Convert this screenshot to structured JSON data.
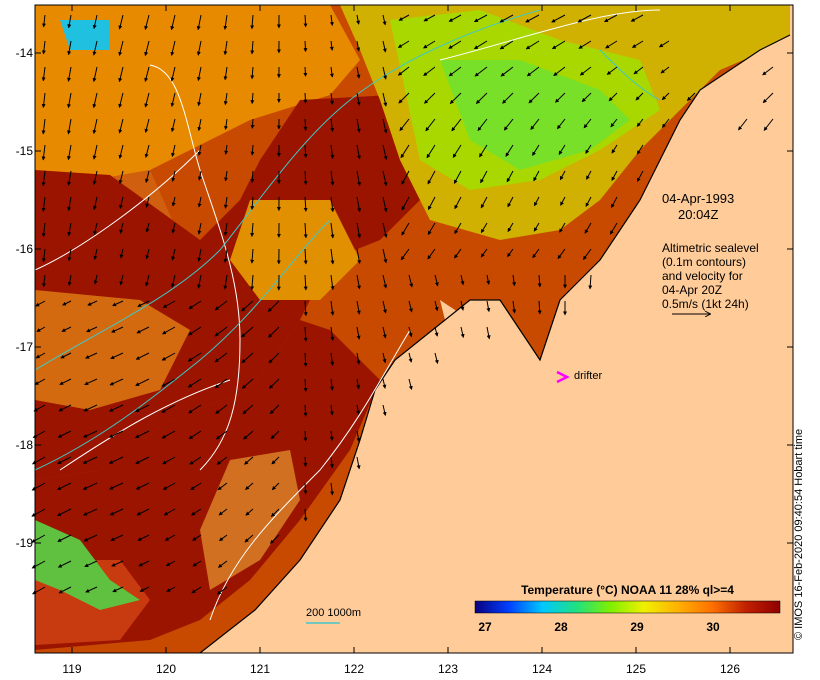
{
  "map": {
    "y_ticks": [
      "-14",
      "-15",
      "-16",
      "-17",
      "-18",
      "-19"
    ],
    "x_ticks": [
      "119",
      "120",
      "121",
      "122",
      "123",
      "124",
      "125",
      "126"
    ],
    "date_line": "04-Apr-1993",
    "time_line": "20:04Z",
    "legend_lines": [
      "Altimetric sealevel",
      "(0.1m contours)",
      "and velocity for",
      "04-Apr 20Z",
      "0.5m/s (1kt 24h)"
    ],
    "drifter_label": "drifter",
    "scale_bar_label": "200  1000m",
    "credit": "© IMOS 16-Feb-2020 09:40:54 Hobart time",
    "colorbar": {
      "title": "Temperature (°C) NOAA 11 28% ql>=4",
      "ticks": [
        "27",
        "28",
        "29",
        "30"
      ],
      "stops": [
        "#0a0080",
        "#0040ff",
        "#00c8ff",
        "#20e080",
        "#80f000",
        "#f0f000",
        "#ffb000",
        "#ff7000",
        "#c02000",
        "#900000"
      ]
    },
    "colors": {
      "land": "#ffcc99",
      "warm_dark": "#9a1400",
      "warm_mid": "#c84a00",
      "warm_light": "#e88a00",
      "green": "#7ee02a",
      "cyan_isobath": "#40c8c8",
      "drifter": "#ff00ff"
    }
  }
}
